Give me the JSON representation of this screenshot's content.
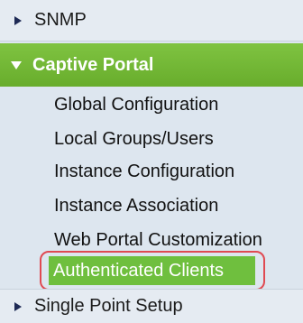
{
  "nav": {
    "snmp": {
      "label": "SNMP",
      "icon": "triangle-right-icon"
    },
    "captive_portal": {
      "label": "Captive Portal",
      "icon": "triangle-down-icon",
      "items": [
        "Global Configuration",
        "Local Groups/Users",
        "Instance Configuration",
        "Instance Association",
        "Web Portal Customization"
      ],
      "active_item": "Authenticated Clients"
    },
    "single_point_setup": {
      "label": "Single Point Setup",
      "icon": "triangle-right-icon"
    }
  },
  "colors": {
    "panel_bg": "#dde6ef",
    "active_green": "#6fbf3e",
    "highlight_red": "#e04a52",
    "arrow_navy": "#1e2a55"
  }
}
